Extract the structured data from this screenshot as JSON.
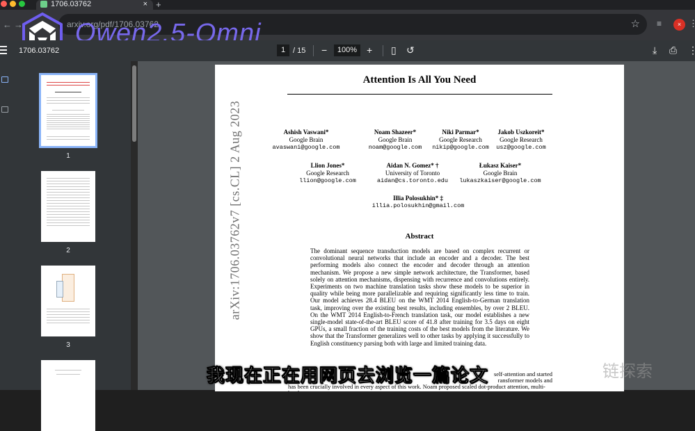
{
  "browser": {
    "tab_title": "1706.03762",
    "tab_close": "×",
    "new_tab": "+",
    "url": "arxiv.org/pdf/1706.03762",
    "star": "☆",
    "profile_initial": "×",
    "menu": "⋮",
    "extension": "≡"
  },
  "brand": {
    "text": "Qwen2.5-Omni"
  },
  "pdf_toolbar": {
    "doc_name": "1706.03762",
    "page_current": "1",
    "page_total": "/ 15",
    "zoom": "100%",
    "zoom_out": "−",
    "zoom_in": "+",
    "fit_icon": "▯",
    "rotate_icon": "↺",
    "download_icon": "⤓",
    "print_icon": "⎙",
    "more_icon": "⋮"
  },
  "thumbnails": [
    {
      "number": "1"
    },
    {
      "number": "2"
    },
    {
      "number": "3"
    }
  ],
  "paper": {
    "title": "Attention Is All You Need",
    "arxiv_stamp": "arXiv:1706.03762v7  [cs.CL]  2 Aug 2023",
    "authors": [
      {
        "name": "Ashish Vaswani*",
        "affil": "Google Brain",
        "email": "avaswani@google.com"
      },
      {
        "name": "Noam Shazeer*",
        "affil": "Google Brain",
        "email": "noam@google.com"
      },
      {
        "name": "Niki Parmar*",
        "affil": "Google Research",
        "email": "nikip@google.com"
      },
      {
        "name": "Jakob Uszkoreit*",
        "affil": "Google Research",
        "email": "usz@google.com"
      },
      {
        "name": "Llion Jones*",
        "affil": "Google Research",
        "email": "llion@google.com"
      },
      {
        "name": "Aidan N. Gomez* †",
        "affil": "University of Toronto",
        "email": "aidan@cs.toronto.edu"
      },
      {
        "name": "Łukasz Kaiser*",
        "affil": "Google Brain",
        "email": "lukaszkaiser@google.com"
      },
      {
        "name": "Illia Polosukhin* ‡",
        "affil": "",
        "email": "illia.polosukhin@gmail.com"
      }
    ],
    "abstract_heading": "Abstract",
    "abstract": "The dominant sequence transduction models are based on complex recurrent or convolutional neural networks that include an encoder and a decoder. The best performing models also connect the encoder and decoder through an attention mechanism. We propose a new simple network architecture, the Transformer, based solely on attention mechanisms, dispensing with recurrence and convolutions entirely. Experiments on two machine translation tasks show these models to be superior in quality while being more parallelizable and requiring significantly less time to train. Our model achieves 28.4 BLEU on the WMT 2014 English-to-German translation task, improving over the existing best results, including ensembles, by over 2 BLEU. On the WMT 2014 English-to-French translation task, our model establishes a new single-model state-of-the-art BLEU score of 41.8 after training for 3.5 days on eight GPUs, a small fraction of the training costs of the best models from the literature. We show that the Transformer generalizes well to other tasks by applying it successfully to English constituency parsing both with large and limited training data.",
    "footnote_1": "self-attention and started",
    "footnote_2": "ransformer models and",
    "footnote_3": "has been crucially involved in every aspect of this work. Noam proposed scaled dot-product attention, multi-head"
  },
  "subtitle": "我现在正在用网页去浏览一篇论文",
  "watermark": "链探索",
  "colors": {
    "brand": "#7c6cf6",
    "accent": "#8ab4f8",
    "toolbar": "#323639",
    "viewer_bg": "#525659"
  }
}
